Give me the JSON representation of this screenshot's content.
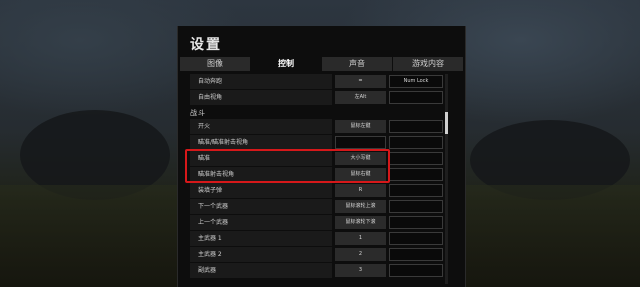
{
  "settings": {
    "title": "设置",
    "tabs": [
      {
        "label": "图像",
        "active": false
      },
      {
        "label": "控制",
        "active": true
      },
      {
        "label": "声音",
        "active": false
      },
      {
        "label": "游戏内容",
        "active": false
      }
    ],
    "top_rows": [
      {
        "label": "自动奔跑",
        "key1": "=",
        "key2": "Num Lock"
      },
      {
        "label": "自由视角",
        "key1": "左Alt",
        "key2": ""
      }
    ],
    "section_combat": "战斗",
    "combat_rows": [
      {
        "label": "开火",
        "key1": "鼠标左键",
        "key2": ""
      },
      {
        "label": "瞄准/瞄准射击视角",
        "key1": "",
        "key2": ""
      },
      {
        "label": "瞄准",
        "key1": "大小写键",
        "key2": ""
      },
      {
        "label": "瞄准射击视角",
        "key1": "鼠标右键",
        "key2": ""
      },
      {
        "label": "装填子弹",
        "key1": "R",
        "key2": ""
      },
      {
        "label": "下一个武器",
        "key1": "鼠标滚轮上滚",
        "key2": ""
      },
      {
        "label": "上一个武器",
        "key1": "鼠标滚轮下滚",
        "key2": ""
      },
      {
        "label": "主武器 1",
        "key1": "1",
        "key2": ""
      },
      {
        "label": "主武器 2",
        "key1": "2",
        "key2": ""
      },
      {
        "label": "副武器",
        "key1": "3",
        "key2": ""
      }
    ],
    "highlight_color": "#d6181a"
  }
}
